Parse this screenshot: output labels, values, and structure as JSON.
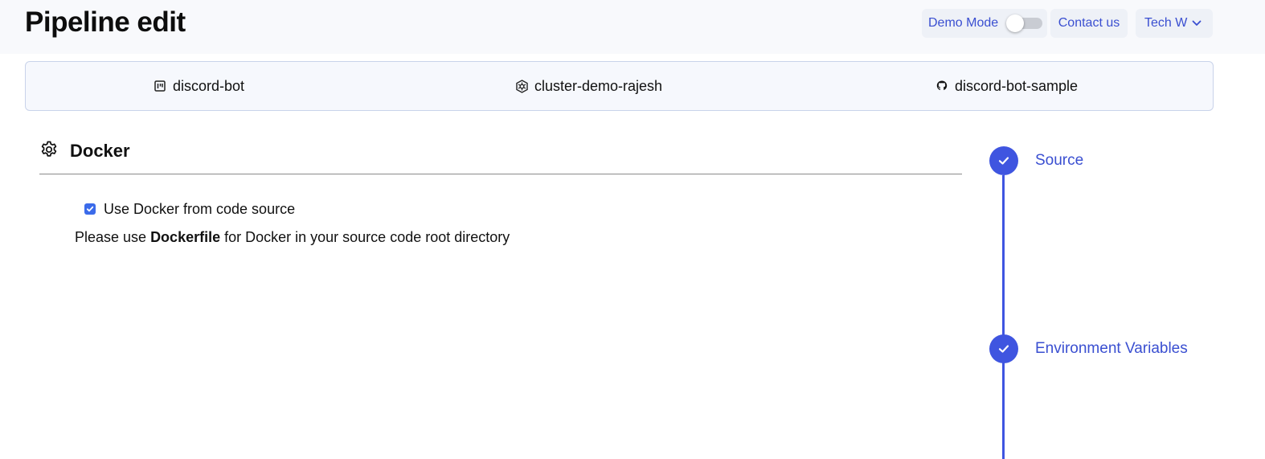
{
  "header": {
    "title": "Pipeline edit",
    "demo_mode_label": "Demo Mode",
    "demo_mode_on": false,
    "contact_label": "Contact us",
    "org_label": "Tech W",
    "accent_color": "#3a4fd1"
  },
  "info": {
    "app_name": "discord-bot",
    "app_icon": "board-icon",
    "cluster_name": "cluster-demo-rajesh",
    "cluster_icon": "kubernetes-icon",
    "repo_name": "discord-bot-sample",
    "repo_icon": "github-icon"
  },
  "section": {
    "title": "Docker",
    "icon": "gear-icon",
    "checkbox_label": "Use Docker from code source",
    "checkbox_checked": true,
    "note_prefix": "Please use ",
    "note_bold": "Dockerfile",
    "note_suffix": " for Docker in your source code root directory"
  },
  "stepper": {
    "color": "#3f55e0",
    "steps": [
      {
        "label": "Source",
        "completed": true
      },
      {
        "label": "Environment Variables",
        "completed": true
      }
    ]
  }
}
